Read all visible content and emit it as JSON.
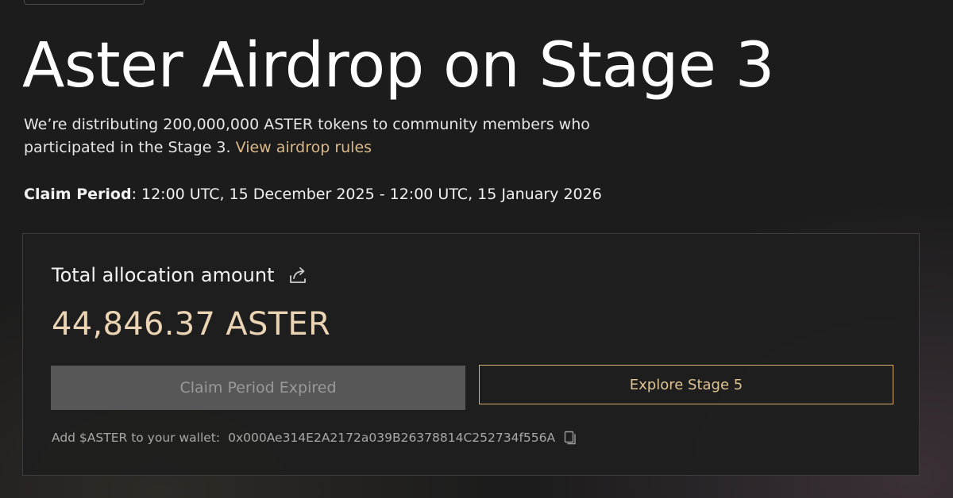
{
  "header": {
    "title": "Aster Airdrop on Stage 3",
    "description_text": "We’re distributing 200,000,000 ASTER tokens to community members who participated in the Stage 3.",
    "rules_link_label": "View airdrop rules",
    "claim_period_label": "Claim Period",
    "claim_period_value": ": 12:00 UTC, 15 December 2025 - 12:00 UTC, 15 January 2026"
  },
  "allocation_card": {
    "title": "Total allocation amount",
    "share_icon": "share-icon",
    "amount": "44,846.37 ASTER",
    "claim_button_label": "Claim Period Expired",
    "explore_button_label": "Explore Stage 5",
    "wallet_label": "Add $ASTER to your wallet:",
    "contract_address": "0x000Ae314E2A2172a039B26378814C252734f556A",
    "copy_icon": "copy-icon"
  },
  "colors": {
    "background": "#1c1c1c",
    "accent_gold": "#d9b98a",
    "amount_color": "#ead4b4",
    "disabled_button_bg": "#575757",
    "explore_border": "#d8ad6d"
  }
}
